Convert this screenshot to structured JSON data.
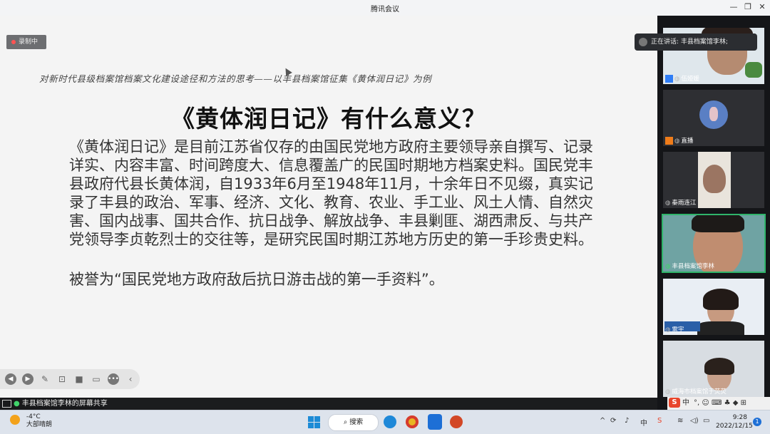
{
  "window": {
    "title": "腾讯会议",
    "minimize": "—",
    "restore": "❐",
    "close": "✕"
  },
  "recording": {
    "label": "录制中"
  },
  "slide": {
    "subtitle": "对新时代县级档案馆档案文化建设途径和方法的思考——以丰县档案馆征集《黄体润日记》为例",
    "heading": "《黄体润日记》有什么意义？",
    "paragraph": "《黄体润日记》是目前江苏省仅存的由国民党地方政府主要领导亲自撰写、记录详实、内容丰富、时间跨度大、信息覆盖广的民国时期地方档案史料。国民党丰县政府代县长黄体润，自1933年6月至1948年11月，十余年日不见缀，真实记录了丰县的政治、军事、经济、文化、教育、农业、手工业、风土人情、自然灾害、国内战事、国共合作、抗日战争、解放战争、丰县剿匪、湖西肃反、与共产党领导李贞乾烈士的交往等，是研究民国时期江苏地方历史的第一手珍贵史料。",
    "paragraph2": "被誉为“国民党地方政府敌后抗日游击战的第一手资料”。"
  },
  "share_bar": {
    "label": "丰县档案馆李林的屏幕共享"
  },
  "speaking": {
    "label": "正在讲话: 丰县档案馆李林;"
  },
  "participants": [
    {
      "name": "伍娅媛"
    },
    {
      "name": "直播"
    },
    {
      "name": "秦雨连江"
    },
    {
      "name": "丰县档案馆李林"
    },
    {
      "name": "雷宇"
    },
    {
      "name": "威海市档案馆于荧荧"
    }
  ],
  "taskbar": {
    "temperature": "-4°C",
    "weather": "大部晴朗",
    "search_label": "搜索",
    "ime_lang": "中",
    "time": "9:28",
    "date": "2022/12/15",
    "notifications": "1"
  },
  "ime_toolbar": {
    "lang": "中",
    "extra": "°, ☺ ⌨ ♣ ◆ ⊞"
  },
  "colors": {
    "accent_green": "#2fb46a",
    "brand_blue": "#1d6fd6",
    "recording_red": "#ff5353"
  }
}
